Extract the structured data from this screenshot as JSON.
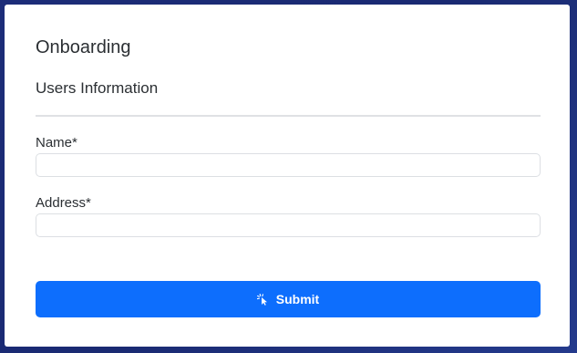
{
  "form": {
    "title": "Onboarding",
    "subtitle": "Users Information",
    "fields": [
      {
        "label": "Name*",
        "value": "",
        "placeholder": ""
      },
      {
        "label": "Address*",
        "value": "",
        "placeholder": ""
      }
    ],
    "submit": {
      "label": "Submit",
      "icon": "cursor-click-icon"
    }
  },
  "colors": {
    "background": "#1c2c78",
    "card": "#ffffff",
    "accent": "#0d6efd",
    "text": "#2b2f33",
    "border": "#dcdfe3"
  }
}
